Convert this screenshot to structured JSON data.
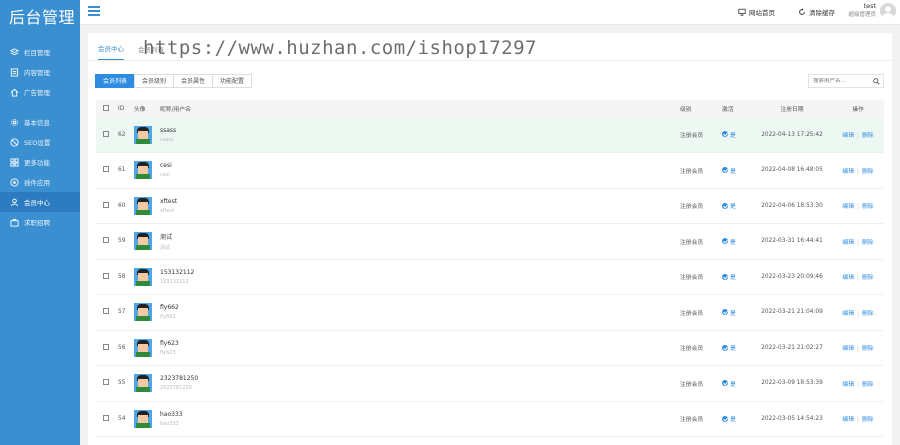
{
  "app": {
    "title": "后台管理"
  },
  "sidebar": {
    "items": [
      {
        "label": "栏目管理",
        "icon": "layers-icon",
        "active": false
      },
      {
        "label": "内容管理",
        "icon": "document-icon",
        "active": false
      },
      {
        "label": "广告管理",
        "icon": "home-icon",
        "active": false
      },
      {
        "label": "基本信息",
        "icon": "gear-icon",
        "active": false
      },
      {
        "label": "SEO设置",
        "icon": "compass-icon",
        "active": false
      },
      {
        "label": "更多功能",
        "icon": "grid-icon",
        "active": false
      },
      {
        "label": "插件应用",
        "icon": "plug-icon",
        "active": false
      },
      {
        "label": "会员中心",
        "icon": "user-icon",
        "active": true
      },
      {
        "label": "求职招聘",
        "icon": "briefcase-icon",
        "active": false
      }
    ]
  },
  "header": {
    "site_home": "网站首页",
    "clear_cache": "清除缓存",
    "user_name": "test",
    "user_role": "超级管理员"
  },
  "breadcrumbs": [
    "会员中心",
    "会员列表"
  ],
  "watermark": "https://www.huzhan.com/ishop17297",
  "tabs": [
    {
      "label": "会员列表",
      "active": true
    },
    {
      "label": "会员级别",
      "active": false
    },
    {
      "label": "会员属性",
      "active": false
    },
    {
      "label": "功能配置",
      "active": false
    }
  ],
  "search": {
    "placeholder": "搜索用户名..."
  },
  "table": {
    "headers": [
      "ID",
      "头像",
      "昵称/用户名",
      "级别",
      "激活",
      "注册日期",
      "操作"
    ],
    "edit_label": "编辑",
    "delete_label": "删除",
    "rows": [
      {
        "id": "62",
        "nickname": "ssass",
        "username": "ssass",
        "level": "注册会员",
        "active": "是",
        "date": "2022-04-13 17:25:42"
      },
      {
        "id": "61",
        "nickname": "cesi",
        "username": "cesi",
        "level": "注册会员",
        "active": "是",
        "date": "2022-04-08 16:48:05"
      },
      {
        "id": "60",
        "nickname": "xftest",
        "username": "xftest",
        "level": "注册会员",
        "active": "是",
        "date": "2022-04-06 18:53:30"
      },
      {
        "id": "59",
        "nickname": "测试",
        "username": "测试",
        "level": "注册会员",
        "active": "是",
        "date": "2022-03-31 16:44:41"
      },
      {
        "id": "58",
        "nickname": "153132112",
        "username": "153132112",
        "level": "注册会员",
        "active": "是",
        "date": "2022-03-23 20:09:46"
      },
      {
        "id": "57",
        "nickname": "fly662",
        "username": "fly662",
        "level": "注册会员",
        "active": "是",
        "date": "2022-03-21 21:04:09"
      },
      {
        "id": "56",
        "nickname": "fly623",
        "username": "fly623",
        "level": "注册会员",
        "active": "是",
        "date": "2022-03-21 21:02:27"
      },
      {
        "id": "55",
        "nickname": "2323781250",
        "username": "2323781250",
        "level": "注册会员",
        "active": "是",
        "date": "2022-03-09 18:53:39"
      },
      {
        "id": "54",
        "nickname": "hao333",
        "username": "hao333",
        "level": "注册会员",
        "active": "是",
        "date": "2022-03-05 14:54:23"
      }
    ]
  },
  "colors": {
    "sidebar": "#3a8fd0",
    "accent": "#2d8ce0",
    "highlight_row": "#eef8f3"
  }
}
